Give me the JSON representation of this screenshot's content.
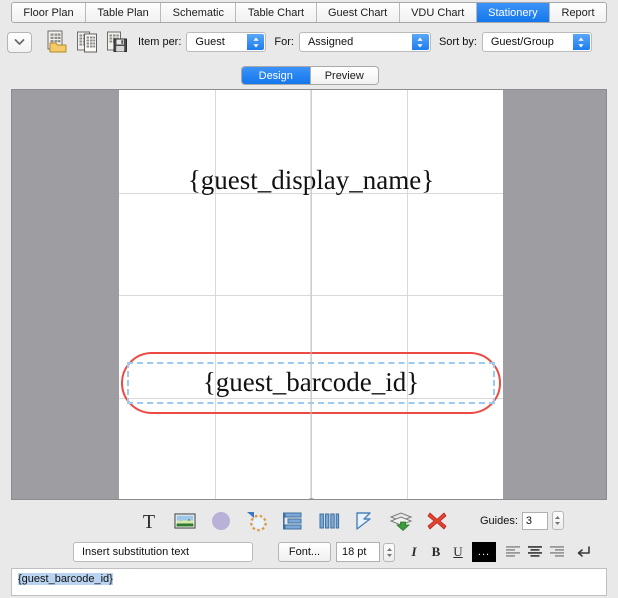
{
  "tabs": [
    {
      "label": "Floor Plan",
      "active": false
    },
    {
      "label": "Table Plan",
      "active": false
    },
    {
      "label": "Schematic",
      "active": false
    },
    {
      "label": "Table Chart",
      "active": false
    },
    {
      "label": "Guest Chart",
      "active": false
    },
    {
      "label": "VDU Chart",
      "active": false
    },
    {
      "label": "Stationery",
      "active": true
    },
    {
      "label": "Report",
      "active": false
    }
  ],
  "toolbar": {
    "overflow_icon": "chevron-down-icon",
    "doc_icons": [
      "open-document-icon",
      "duplicate-document-icon",
      "save-document-icon"
    ],
    "item_per_label": "Item per:",
    "item_per_value": "Guest",
    "for_label": "For:",
    "for_value": "Assigned",
    "sort_by_label": "Sort by:",
    "sort_by_value": "Guest/Group"
  },
  "mode_toggle": {
    "design_label": "Design",
    "preview_label": "Preview",
    "active": "Design"
  },
  "canvas": {
    "guest_display_name": "{guest_display_name}",
    "guest_barcode_id": "{guest_barcode_id}",
    "selection_color": "#ec4a42",
    "selection_handle_color": "#9ccaf0",
    "page_background": "#ffffff",
    "canvas_background": "#9d9da2"
  },
  "shape_toolbar": {
    "buttons": [
      "text-tool-icon",
      "image-tool-icon",
      "circle-shape-icon",
      "shape-tool-icon",
      "align-objects-icon",
      "distribute-objects-icon",
      "rotate-tool-icon",
      "layers-icon",
      "delete-icon"
    ],
    "guides_label": "Guides:",
    "guides_value": "3"
  },
  "format_bar": {
    "substitution_value": "Insert substitution text",
    "font_button_label": "Font...",
    "font_size_value": "18 pt",
    "italic_label": "I",
    "bold_label": "B",
    "underline_label": "U",
    "color_swatch_label": "...",
    "color_swatch_value": "#000000",
    "align_left_icon": "align-left-icon",
    "align_center_icon": "align-center-icon",
    "align_right_icon": "align-right-icon",
    "wrap_icon": "line-break-icon",
    "active_alignment": "center"
  },
  "status_field": {
    "text": "{guest_barcode_id}"
  }
}
